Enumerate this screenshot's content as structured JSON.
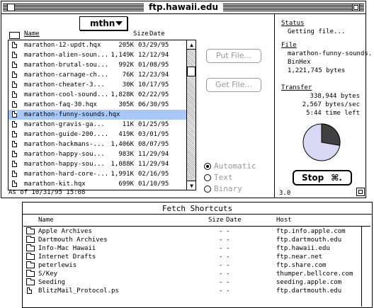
{
  "ftp_window": {
    "title": "ftp.hawaii.edu",
    "folder_popup": "mthn",
    "columns": {
      "name": "Name",
      "size": "Size",
      "date": "Date"
    },
    "files": [
      {
        "name": "marathon-12-updt.hqx",
        "size": "205K",
        "date": "03/29/95"
      },
      {
        "name": "marathon-alien-soun...",
        "size": "1,149K",
        "date": "12/12/94"
      },
      {
        "name": "marathon-brutal-sou...",
        "size": "992K",
        "date": "01/08/95"
      },
      {
        "name": "marathon-carnage-ch...",
        "size": "76K",
        "date": "12/23/94"
      },
      {
        "name": "marathon-cheater-3...",
        "size": "30K",
        "date": "10/17/95"
      },
      {
        "name": "marathon-cool-sound...",
        "size": "1,828K",
        "date": "02/22/95"
      },
      {
        "name": "marathon-faq-30.hqx",
        "size": "305K",
        "date": "06/30/95"
      },
      {
        "name": "marathon-funny-sounds.hqx",
        "size": "",
        "date": "",
        "selected": true
      },
      {
        "name": "marathon-gravis-ga...",
        "size": "11K",
        "date": "01/25/95"
      },
      {
        "name": "marathon-guide-200....",
        "size": "419K",
        "date": "03/01/95"
      },
      {
        "name": "marathon-hackmans-...",
        "size": "1,406K",
        "date": "08/07/95"
      },
      {
        "name": "marathon-happy-sou...",
        "size": "983K",
        "date": "11/29/94"
      },
      {
        "name": "marathon-happy-sou...",
        "size": "1,088K",
        "date": "11/29/94"
      },
      {
        "name": "marathon-hard-core-...",
        "size": "1,991K",
        "date": "02/16/95"
      },
      {
        "name": "marathon-kit.hqx",
        "size": "699K",
        "date": "01/10/95"
      }
    ],
    "as_of": "As of 10/31/95 15:08",
    "put_button": "Put File...",
    "get_button": "Get File...",
    "mode_options": [
      "Automatic",
      "Text",
      "Binary"
    ],
    "mode_selected": "Automatic"
  },
  "status_panel": {
    "status_heading": "Status",
    "status_text": "Getting file...",
    "file_heading": "File",
    "file_name": "marathon-funny-sounds.",
    "file_format": "BinHex",
    "file_size": "1,221,745 bytes",
    "transfer_heading": "Transfer",
    "transferred": "338,944 bytes",
    "rate": "2,567 bytes/sec",
    "time_left": "5:44 time left",
    "progress_fraction": 0.2774,
    "stop_label": "Stop",
    "stop_shortcut": "⌘.",
    "version": "3.0"
  },
  "shortcuts_window": {
    "title": "Fetch Shortcuts",
    "columns": {
      "name": "Name",
      "size": "Size",
      "date": "Date",
      "host": "Host"
    },
    "items": [
      {
        "name": "Apple Archives",
        "size": "-",
        "date": "-",
        "host": "ftp.info.apple.com",
        "icon": "folder"
      },
      {
        "name": "Dartmouth Archives",
        "size": "-",
        "date": "-",
        "host": "ftp.dartmouth.edu",
        "icon": "folder"
      },
      {
        "name": "Info-Mac Hawaii",
        "size": "-",
        "date": "-",
        "host": "ftp.hawaii.edu",
        "icon": "folder"
      },
      {
        "name": "Internet Drafts",
        "size": "-",
        "date": "-",
        "host": "ftp.near.net",
        "icon": "folder"
      },
      {
        "name": "peterlewis",
        "size": "-",
        "date": "-",
        "host": "ftp.share.com",
        "icon": "folder"
      },
      {
        "name": "S/Key",
        "size": "-",
        "date": "-",
        "host": "thumper.bellcore.com",
        "icon": "folder"
      },
      {
        "name": "Seeding",
        "size": "-",
        "date": "-",
        "host": "seeding.apple.com",
        "icon": "folder"
      },
      {
        "name": "BlitzMail_Protocol.ps",
        "size": "-",
        "date": "-",
        "host": "ftp.dartmouth.edu",
        "icon": "document"
      }
    ]
  }
}
